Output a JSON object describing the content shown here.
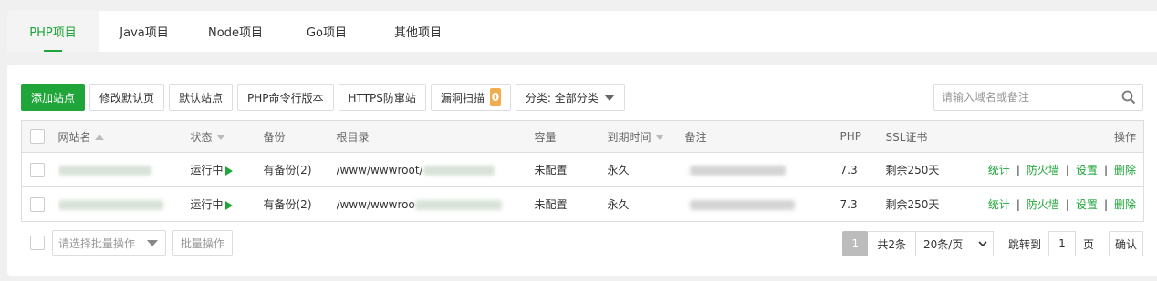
{
  "tabs": [
    {
      "label": "PHP项目",
      "active": true
    },
    {
      "label": "Java项目"
    },
    {
      "label": "Node项目"
    },
    {
      "label": "Go项目"
    },
    {
      "label": "其他项目"
    }
  ],
  "toolbar": {
    "add_site": "添加站点",
    "modify_default_page": "修改默认页",
    "default_site": "默认站点",
    "php_cli_version": "PHP命令行版本",
    "https_anti_hijack": "HTTPS防窜站",
    "vuln_scan": "漏洞扫描",
    "vuln_scan_count": "0",
    "category_select": "分类: 全部分类"
  },
  "search": {
    "placeholder": "请输入域名或备注",
    "value": ""
  },
  "table": {
    "headers": {
      "site_name": "网站名",
      "status": "状态",
      "backup": "备份",
      "root_dir": "根目录",
      "capacity": "容量",
      "expiry": "到期时间",
      "remark": "备注",
      "php": "PHP",
      "ssl": "SSL证书",
      "actions": "操作"
    },
    "rows": [
      {
        "status": "运行中",
        "backup": "有备份(2)",
        "root_dir": "/www/wwwroot/",
        "capacity": "未配置",
        "expiry": "永久",
        "php": "7.3",
        "ssl": "剩余250天",
        "actions": [
          "统计",
          "防火墙",
          "设置",
          "删除"
        ]
      },
      {
        "status": "运行中",
        "backup": "有备份(2)",
        "root_dir": "/www/wwwroo",
        "capacity": "未配置",
        "expiry": "永久",
        "php": "7.3",
        "ssl": "剩余250天",
        "actions": [
          "统计",
          "防火墙",
          "设置",
          "删除"
        ]
      }
    ]
  },
  "footer": {
    "batch_select_placeholder": "请选择批量操作",
    "batch_action": "批量操作",
    "current_page": "1",
    "total": "共2条",
    "page_size": "20条/页",
    "jump_label": "跳转到",
    "jump_value": "1",
    "page_unit": "页",
    "confirm": "确认"
  },
  "colors": {
    "accent": "#20a53a",
    "badge": "#f0ad4e"
  }
}
